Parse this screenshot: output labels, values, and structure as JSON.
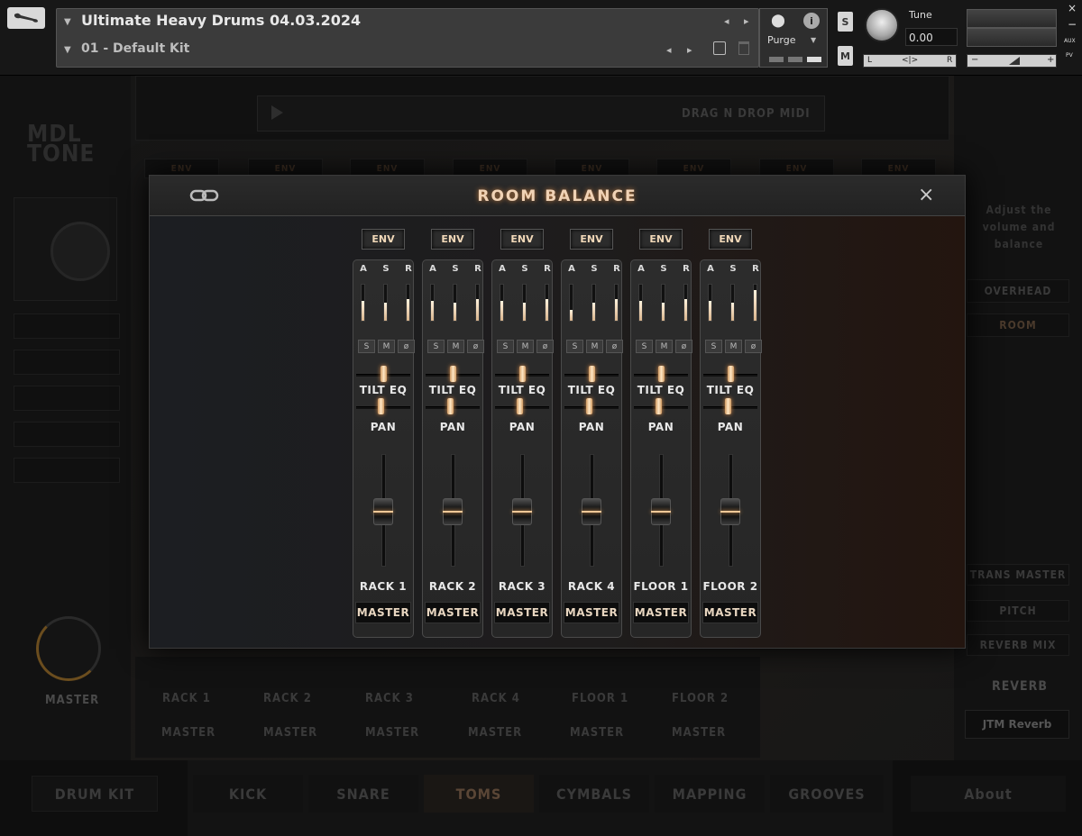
{
  "header": {
    "instrument_title": "Ultimate Heavy Drums 04.03.2024",
    "preset_name": "01 - Default Kit",
    "purge_label": "Purge",
    "solo_label": "S",
    "mute_label": "M",
    "tune_label": "Tune",
    "tune_value": "0.00",
    "pan_left": "L",
    "pan_center": "<|>",
    "pan_right": "R",
    "vol_minus": "−",
    "vol_plus": "+",
    "aux_label": "AUX",
    "pv_label": "PV",
    "close_label": "×",
    "minimize_label": "−"
  },
  "background": {
    "logo_line1": "MDL",
    "logo_line2": "TONE",
    "drag_drop_label": "DRAG N DROP MIDI",
    "env_labels": [
      "ENV",
      "ENV",
      "ENV",
      "ENV",
      "ENV",
      "ENV",
      "ENV",
      "ENV"
    ],
    "master_knob_label": "MASTER",
    "channel_names": [
      "RACK 1",
      "RACK 2",
      "RACK 3",
      "RACK 4",
      "FLOOR 1",
      "FLOOR 2"
    ],
    "channel_outputs": [
      "MASTER",
      "MASTER",
      "MASTER",
      "MASTER",
      "MASTER",
      "MASTER"
    ],
    "right_panel": {
      "hint": "Adjust the volume and balance",
      "overhead": "OVERHEAD",
      "room": "ROOM",
      "trans_master": "TRANS MASTER",
      "pitch": "PITCH",
      "reverb_mix": "REVERB MIX",
      "reverb": "REVERB",
      "reverb_preset": "JTM Reverb"
    },
    "tabs": {
      "drum_kit": "DRUM KIT",
      "kick": "KICK",
      "snare": "SNARE",
      "toms": "TOMS",
      "cymbals": "CYMBALS",
      "mapping": "MAPPING",
      "grooves": "GROOVES",
      "about": "About"
    }
  },
  "modal": {
    "title": "ROOM BALANCE",
    "close": "×",
    "strips": [
      {
        "env": "ENV",
        "a": "A",
        "s": "S",
        "r": "R",
        "solo": "S",
        "mute": "M",
        "phase": "ø",
        "tilt": "TILT EQ",
        "pan": "PAN",
        "name": "RACK 1",
        "output": "MASTER",
        "asr_levels": [
          0.55,
          0.5,
          0.6
        ],
        "fader": 0.55
      },
      {
        "env": "ENV",
        "a": "A",
        "s": "S",
        "r": "R",
        "solo": "S",
        "mute": "M",
        "phase": "ø",
        "tilt": "TILT EQ",
        "pan": "PAN",
        "name": "RACK 2",
        "output": "MASTER",
        "asr_levels": [
          0.55,
          0.5,
          0.6
        ],
        "fader": 0.55
      },
      {
        "env": "ENV",
        "a": "A",
        "s": "S",
        "r": "R",
        "solo": "S",
        "mute": "M",
        "phase": "ø",
        "tilt": "TILT EQ",
        "pan": "PAN",
        "name": "RACK 3",
        "output": "MASTER",
        "asr_levels": [
          0.55,
          0.5,
          0.6
        ],
        "fader": 0.55
      },
      {
        "env": "ENV",
        "a": "A",
        "s": "S",
        "r": "R",
        "solo": "S",
        "mute": "M",
        "phase": "ø",
        "tilt": "TILT EQ",
        "pan": "PAN",
        "name": "RACK 4",
        "output": "MASTER",
        "asr_levels": [
          0.3,
          0.5,
          0.6
        ],
        "fader": 0.55
      },
      {
        "env": "ENV",
        "a": "A",
        "s": "S",
        "r": "R",
        "solo": "S",
        "mute": "M",
        "phase": "ø",
        "tilt": "TILT EQ",
        "pan": "PAN",
        "name": "FLOOR 1",
        "output": "MASTER",
        "asr_levels": [
          0.55,
          0.5,
          0.6
        ],
        "fader": 0.55
      },
      {
        "env": "ENV",
        "a": "A",
        "s": "S",
        "r": "R",
        "solo": "S",
        "mute": "M",
        "phase": "ø",
        "tilt": "TILT EQ",
        "pan": "PAN",
        "name": "FLOOR 2",
        "output": "MASTER",
        "asr_levels": [
          0.55,
          0.5,
          0.85
        ],
        "fader": 0.55
      }
    ]
  }
}
